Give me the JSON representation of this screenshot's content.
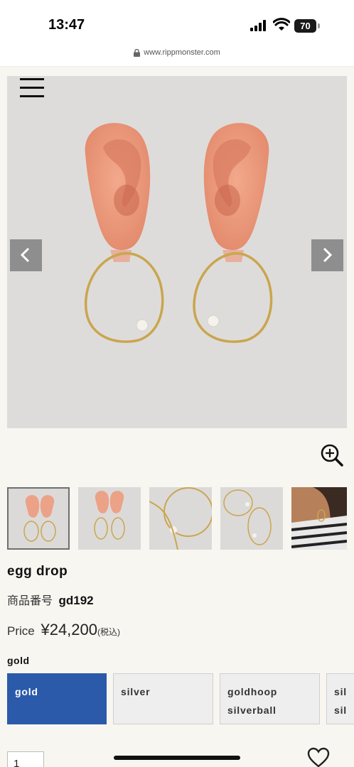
{
  "status_bar": {
    "time": "13:47",
    "battery": "70"
  },
  "browser": {
    "url": "www.rippmonster.com"
  },
  "product": {
    "name": "egg drop",
    "code_label": "商品番号",
    "code": "gd192",
    "price_label": "Price",
    "price": "¥24,200",
    "tax_note": "(税込)"
  },
  "options": {
    "label": "gold",
    "items": [
      {
        "line1": "gold",
        "line2": ""
      },
      {
        "line1": "silver",
        "line2": ""
      },
      {
        "line1": "goldhoop",
        "line2": "silverball"
      },
      {
        "line1": "sil",
        "line2": "sil"
      }
    ]
  },
  "quantity": "1",
  "colors": {
    "accent": "#2b5aab",
    "background": "#f8f6f1"
  }
}
